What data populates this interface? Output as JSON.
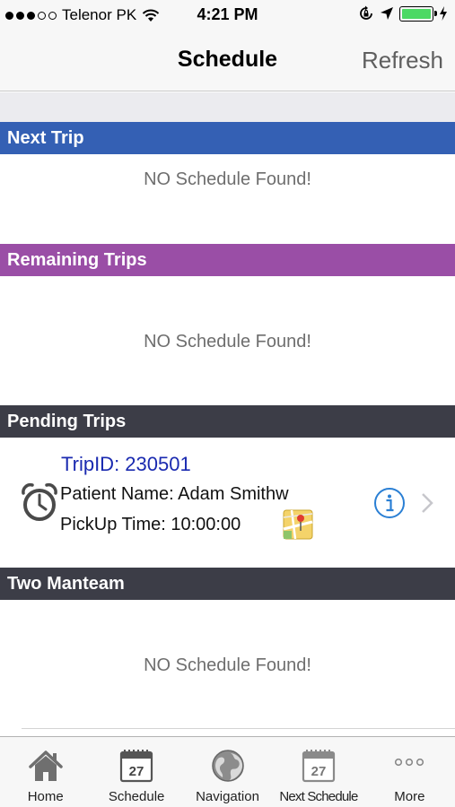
{
  "status_bar": {
    "carrier": "Telenor PK",
    "time": "4:21 PM"
  },
  "nav": {
    "title": "Schedule",
    "refresh_label": "Refresh"
  },
  "sections": {
    "next_trip": {
      "title": "Next Trip",
      "empty_message": "NO Schedule Found!",
      "color": "#3460b4"
    },
    "remaining_trips": {
      "title": "Remaining Trips",
      "empty_message": "NO Schedule Found!",
      "color": "#9a4ea6"
    },
    "pending_trips": {
      "title": "Pending Trips",
      "color": "#3c3d47",
      "trip": {
        "trip_id": "TripID: 230501",
        "patient": "Patient Name: Adam Smithw",
        "pickup": "PickUp Time: 10:00:00"
      }
    },
    "two_manteam": {
      "title": "Two Manteam",
      "empty_message": "NO Schedule Found!",
      "color": "#3c3d47"
    }
  },
  "tab_bar": {
    "tabs": [
      {
        "label": "Home",
        "icon": "home-icon"
      },
      {
        "label": "Schedule",
        "icon": "calendar-icon",
        "day": "27"
      },
      {
        "label": "Navigation",
        "icon": "globe-icon"
      },
      {
        "label": "Next Schedule",
        "icon": "calendar-icon",
        "day": "27"
      },
      {
        "label": "More",
        "icon": "more-icon"
      }
    ]
  }
}
